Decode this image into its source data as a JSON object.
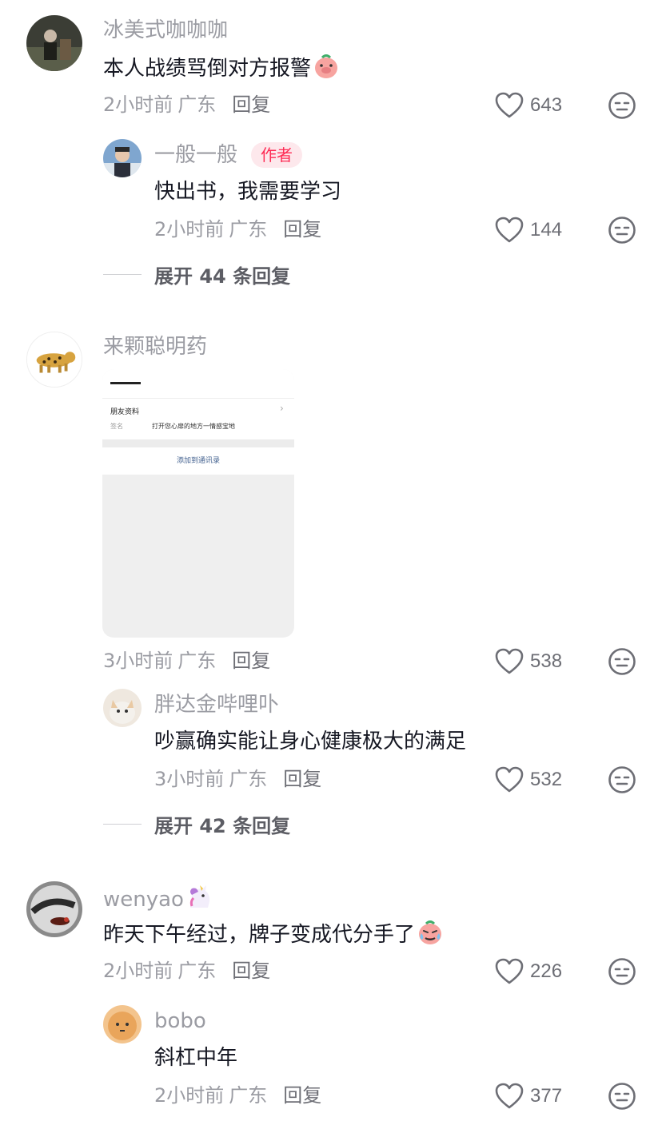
{
  "comments": [
    {
      "username": "冰美式咖咖咖",
      "text": "本人战绩骂倒对方报警",
      "text_emoji": "pig-face-emoji",
      "time": "2小时前",
      "location": "广东",
      "reply_label": "回复",
      "likes": "643",
      "replies": [
        {
          "username": "一般一般",
          "author_tag": "作者",
          "text": "快出书，我需要学习",
          "time": "2小时前",
          "location": "广东",
          "reply_label": "回复",
          "likes": "144"
        }
      ],
      "expand_label": "展开 44 条回复"
    },
    {
      "username": "来颗聪明药",
      "attachment": {
        "section_title": "朋友资料",
        "sign_label": "签名",
        "sign_value": "打开您心扉的地方一情感宝地",
        "add_contact": "添加到通讯录"
      },
      "time": "3小时前",
      "location": "广东",
      "reply_label": "回复",
      "likes": "538",
      "replies": [
        {
          "username": "胖达金哔哩卟",
          "text": "吵赢确实能让身心健康极大的满足",
          "time": "3小时前",
          "location": "广东",
          "reply_label": "回复",
          "likes": "532"
        }
      ],
      "expand_label": "展开 42 条回复"
    },
    {
      "username": "wenyao",
      "username_emoji": "unicorn-emoji",
      "text": "昨天下午经过，牌子变成代分手了",
      "text_emoji": "crying-face-emoji",
      "time": "2小时前",
      "location": "广东",
      "reply_label": "回复",
      "likes": "226",
      "replies": [
        {
          "username": "bobo",
          "text": "斜杠中年",
          "time": "2小时前",
          "location": "广东",
          "reply_label": "回复",
          "likes": "377"
        }
      ]
    }
  ],
  "colors": {
    "username": "#9b9ca3",
    "text": "#161823",
    "author_tag_bg": "#fde8ec",
    "author_tag_fg": "#fe2c55"
  }
}
